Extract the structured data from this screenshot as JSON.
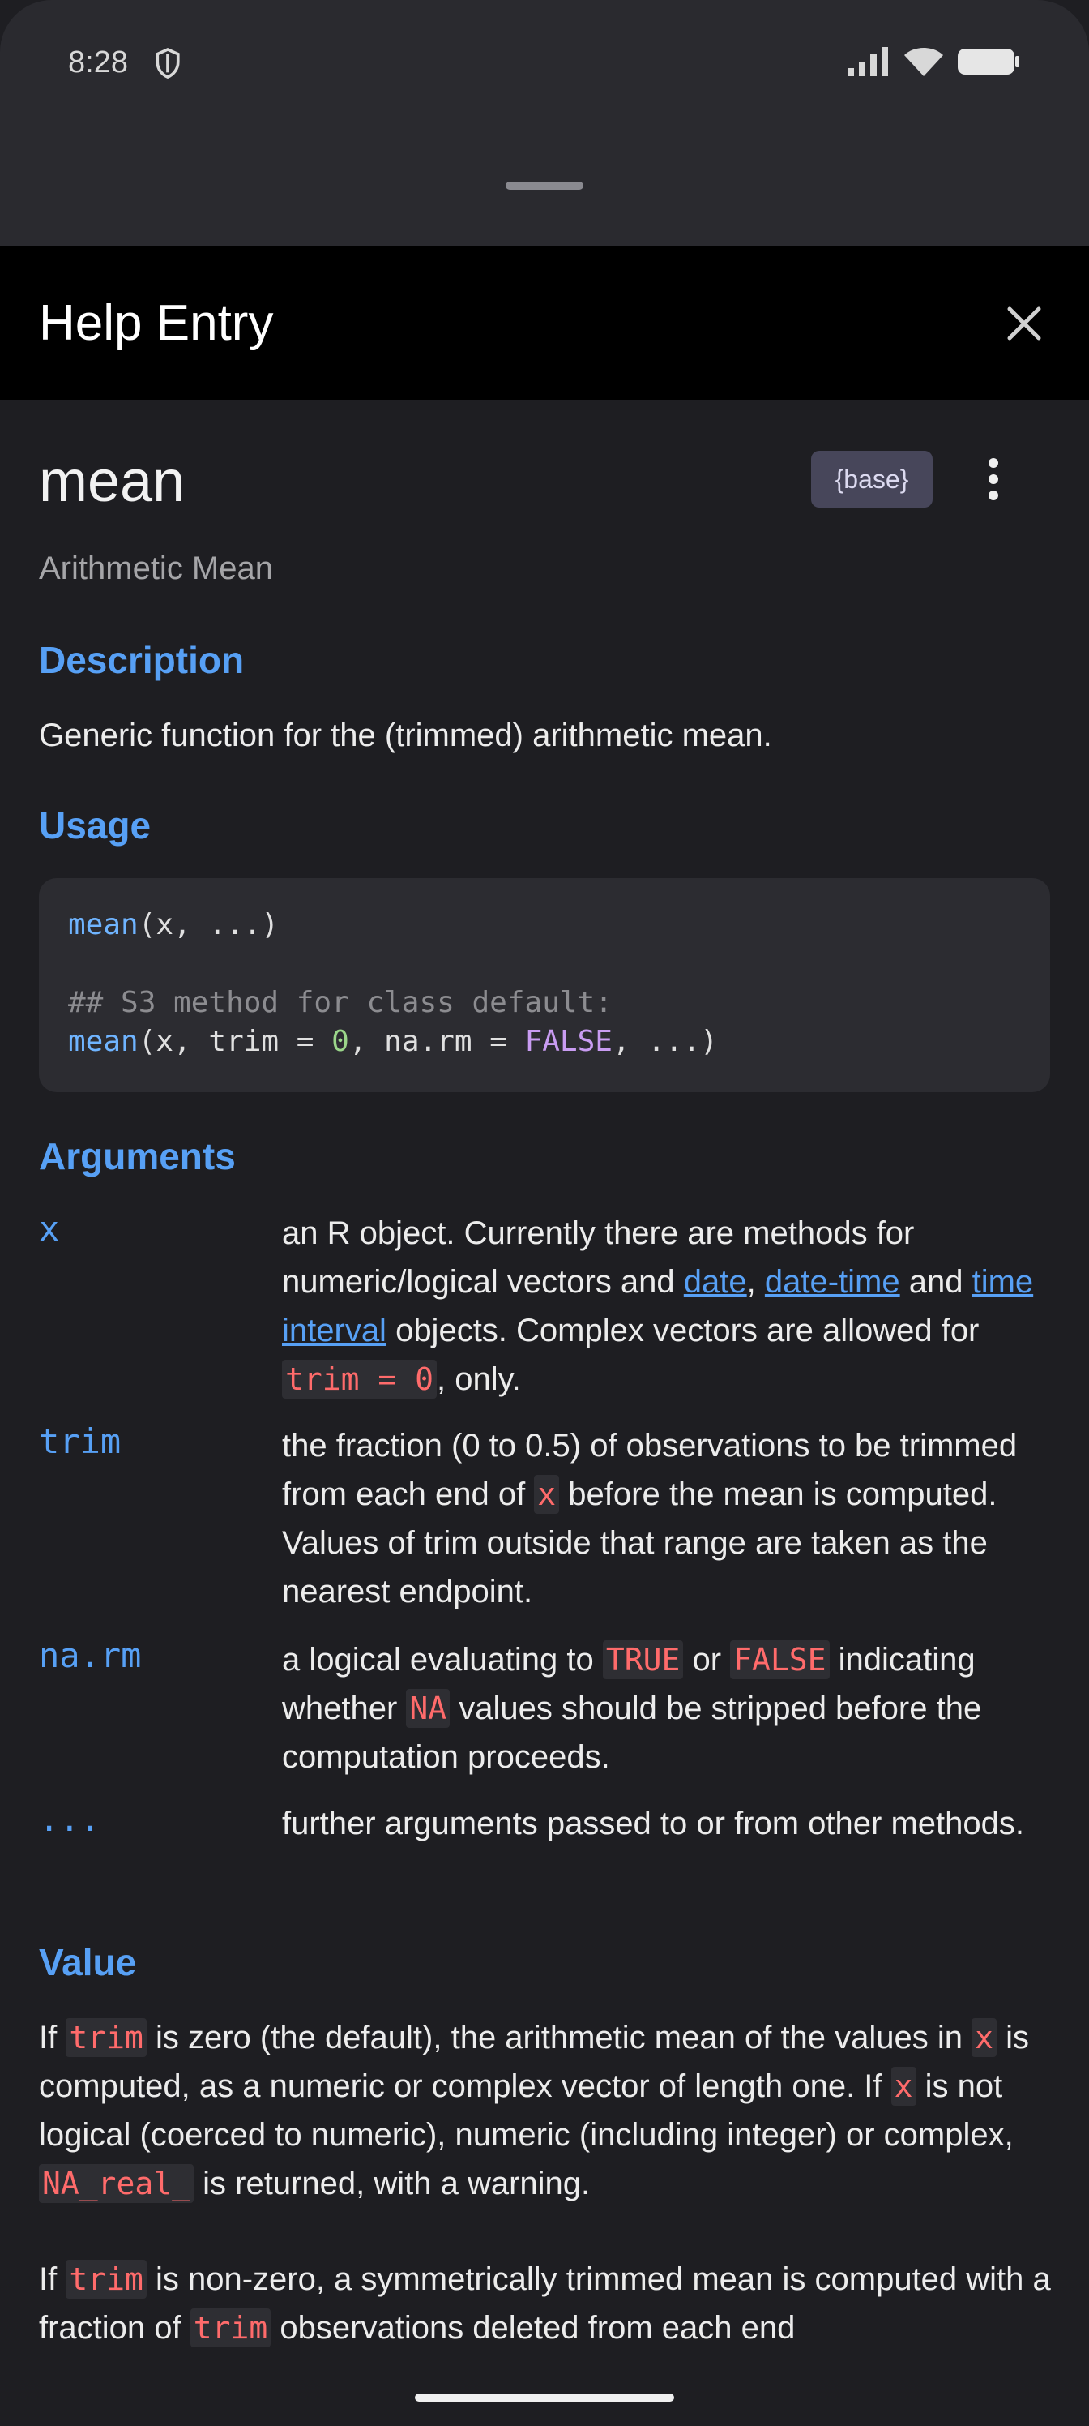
{
  "status_bar": {
    "time": "8:28"
  },
  "header": {
    "title": "Help Entry"
  },
  "entry": {
    "name": "mean",
    "package": "{base}",
    "title": "Arithmetic Mean"
  },
  "sections": {
    "description": "Description",
    "usage": "Usage",
    "arguments": "Arguments",
    "value": "Value"
  },
  "description_text": "Generic function for the (trimmed) arithmetic mean.",
  "usage_code": {
    "l1_fn": "mean",
    "l1_rest": "(x, ...)",
    "l3": "## S3 method for class default:",
    "l4_fn": "mean",
    "l4_a": "(x, trim = ",
    "l4_num": "0",
    "l4_b": ", na.rm = ",
    "l4_kw": "FALSE",
    "l4_c": ", ...)"
  },
  "arguments": {
    "x": {
      "name": "x",
      "t1": "an R object. Currently there are methods for numeric/logical vectors and ",
      "link1": "date",
      "t2": ", ",
      "link2": "date-time",
      "t3": " and ",
      "link3": "time interval",
      "t4": " objects. Complex vectors are allowed for ",
      "code1": "trim = 0",
      "t5": ", only."
    },
    "trim": {
      "name": "trim",
      "t1": "the fraction (0 to 0.5) of observations to be trimmed from each end of ",
      "code1": "x",
      "t2": " before the mean is computed. Values of trim outside that range are taken as the nearest endpoint."
    },
    "narm": {
      "name": "na.rm",
      "t1": "a logical evaluating to ",
      "code1": "TRUE",
      "t2": " or ",
      "code2": "FALSE",
      "t3": " indicating whether ",
      "code3": "NA",
      "t4": " values should be stripped before the computation proceeds."
    },
    "dots": {
      "name": "...",
      "t1": "further arguments passed to or from other methods."
    }
  },
  "value_p1": {
    "t1": "If ",
    "c1": "trim",
    "t2": " is zero (the default), the arithmetic mean of the values in ",
    "c2": "x",
    "t3": " is computed, as a numeric or complex vector of length one. If ",
    "c3": "x",
    "t4": " is not logical (coerced to numeric), numeric (including integer) or complex, ",
    "c4": "NA_real_",
    "t5": " is returned, with a warning."
  },
  "value_p2": {
    "t1": "If ",
    "c1": "trim",
    "t2": " is non-zero, a symmetrically trimmed mean is computed with a fraction of ",
    "c2": "trim",
    "t3": " observations deleted from each end"
  },
  "colors": {
    "accent": "#57a0f5",
    "inline_code": "#ff6b6b",
    "background": "#1e1e22",
    "header": "#000000"
  }
}
